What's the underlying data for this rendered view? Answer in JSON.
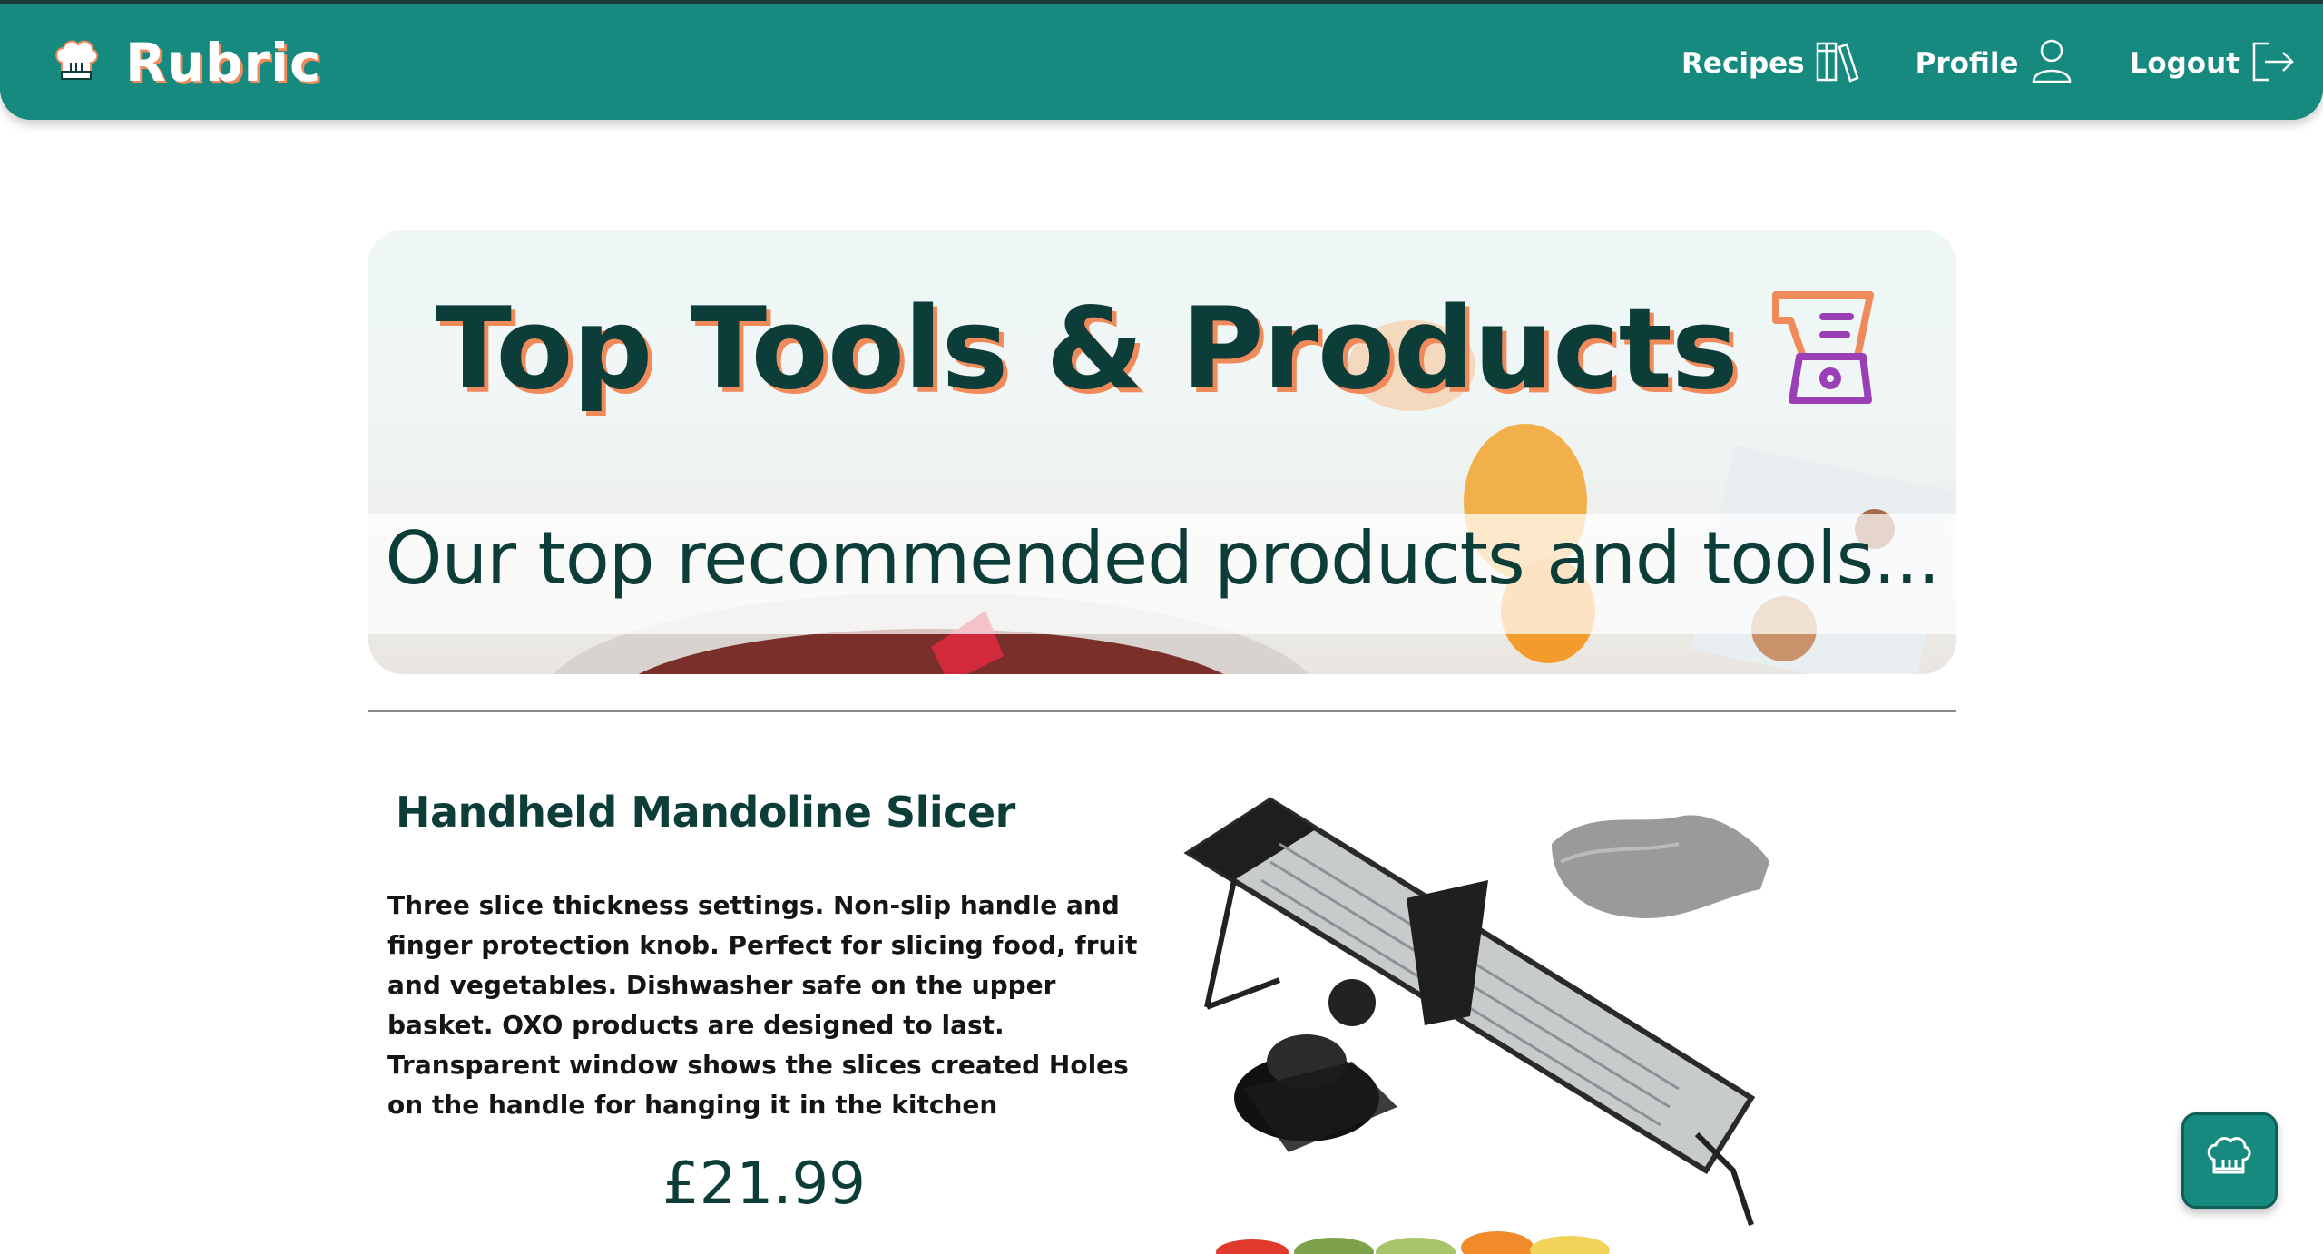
{
  "brand": {
    "name": "Rubric",
    "logo_icon": "chef-hat-icon"
  },
  "nav": {
    "items": [
      {
        "label": "Recipes",
        "icon": "books-icon"
      },
      {
        "label": "Profile",
        "icon": "user-icon"
      },
      {
        "label": "Logout",
        "icon": "logout-icon"
      }
    ]
  },
  "hero": {
    "title": "Top Tools & Products",
    "title_icon": "blender-icon",
    "subtitle": "Our top recommended products and tools..."
  },
  "product": {
    "name": "Handheld Mandoline Slicer",
    "description": "Three slice thickness settings. Non-slip handle and finger protection knob. Perfect for slicing food, fruit and vegetables. Dishwasher safe on the upper basket. OXO products are designed to last. Transparent window shows the slices created Holes on the handle for hanging it in the kitchen",
    "price": "£21.99",
    "image": "mandoline-slicer-image"
  },
  "fab": {
    "icon": "chef-hat-icon"
  },
  "colors": {
    "primary": "#168a7f",
    "heading": "#0d3d38",
    "accent": "#f08a5a",
    "icon_purple": "#9a3fb5"
  }
}
